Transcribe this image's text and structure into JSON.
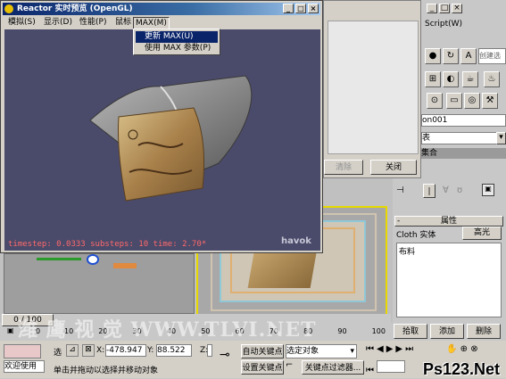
{
  "reactor": {
    "title": "Reactor 实时预览 (OpenGL)",
    "menu": [
      "模拟(S)",
      "显示(D)",
      "性能(P)",
      "鼠标",
      "MAX(M)"
    ],
    "dropdown": [
      "更新 MAX(U)",
      "使用 MAX 参数(P)"
    ],
    "status_text": "timestep: 0.0333 substeps: 10 time: 2.70*",
    "logo": "havok"
  },
  "dialog": {
    "clear_label": "清除",
    "close_label": "关闭"
  },
  "cmd_panel": {
    "script_label": "Script(W)",
    "create_set_label": "创建选",
    "object_name": "on001",
    "table_label": "表",
    "collection_label": "集合",
    "rollout_title": "属性",
    "cloth_label": "Cloth 实体",
    "highlight_label": "高光",
    "cloth_item": "布料",
    "pick_label": "拾取",
    "add_label": "添加",
    "delete_label": "删除"
  },
  "timeline": {
    "frame_label": "0 / 100",
    "ruler_label": "0",
    "ticks": [
      "10",
      "20",
      "30",
      "40",
      "50",
      "60",
      "70",
      "80",
      "90",
      "100"
    ]
  },
  "statusbar": {
    "welcome": "欢迎使用",
    "select_label": "选",
    "x_label": "X:",
    "x_value": "-478.947",
    "y_label": "Y:",
    "y_value": "88.522",
    "z_label": "Z:",
    "prompt": "单击并拖动以选择并移动对象",
    "auto_key": "自动关键点",
    "set_key": "设置关键点",
    "selected_object": "选定对象",
    "key_filter": "关键点过滤器..."
  },
  "watermarks": {
    "site1": "潍 鹰 视 觉 WWW.TLVI.NET",
    "site2": "Ps123.Net"
  }
}
